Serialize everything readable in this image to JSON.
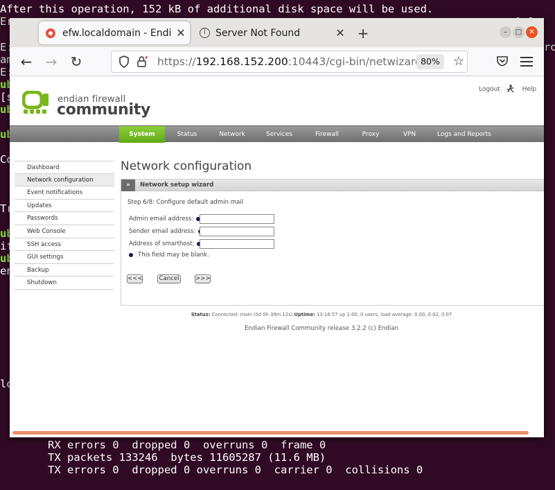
{
  "terminal": {
    "lines_top": [
      {
        "text": "After this operation, 152 kB of additional disk space will be used.",
        "style": "normal"
      },
      {
        "text": "Er",
        "style": "dim"
      },
      {
        "text": "E:",
        "style": "dim"
      },
      {
        "text": "am",
        "style": "dim"
      },
      {
        "text": "E:",
        "style": "dim"
      },
      {
        "text": "ub",
        "style": "green"
      },
      {
        "text": "[s",
        "style": "normal"
      },
      {
        "text": "ub",
        "style": "green"
      },
      {
        "text": "ub",
        "style": "green"
      },
      {
        "text": "Co",
        "style": "normal"
      },
      {
        "text": "Tr",
        "style": "normal"
      },
      {
        "text": "ub",
        "style": "green"
      },
      {
        "text": "if",
        "style": "normal"
      },
      {
        "text": "ub",
        "style": "green"
      },
      {
        "text": "en",
        "style": "normal"
      },
      {
        "text": "lo",
        "style": "normal"
      }
    ],
    "right_fragments": [
      "0-2",
      "rou"
    ],
    "lines_bottom": [
      "RX errors 0  dropped 0  overruns 0  frame 0",
      "TX packets 133246  bytes 11605287 (11.6 MB)",
      "TX errors 0  dropped 0 overruns 0  carrier 0  collisions 0"
    ]
  },
  "browser": {
    "tabs": [
      {
        "label": "efw.localdomain - Endian",
        "active": true,
        "icon": "endian-favicon"
      },
      {
        "label": "Server Not Found",
        "active": false,
        "icon": "info-icon"
      }
    ],
    "new_tab_label": "+",
    "url": {
      "scheme": "https://",
      "host": "192.168.152.200",
      "rest": ":10443/cgi-bin/netwizard.cgi"
    },
    "zoom": "80%"
  },
  "endian": {
    "logo": {
      "line1": "endian firewall",
      "line2": "community",
      "colors": {
        "green": "#7ab51d",
        "text": "#444444"
      }
    },
    "top_links": {
      "logout": "Logout",
      "help": "Help"
    },
    "menu": [
      {
        "label": "System",
        "active": true
      },
      {
        "label": "Status",
        "active": false
      },
      {
        "label": "Network",
        "active": false
      },
      {
        "label": "Services",
        "active": false
      },
      {
        "label": "Firewall",
        "active": false
      },
      {
        "label": "Proxy",
        "active": false
      },
      {
        "label": "VPN",
        "active": false
      },
      {
        "label": "Logs and Reports",
        "active": false
      }
    ],
    "sidebar": [
      {
        "label": "Dashboard",
        "active": false
      },
      {
        "label": "Network configuration",
        "active": true
      },
      {
        "label": "Event notifications",
        "active": false
      },
      {
        "label": "Updates",
        "active": false
      },
      {
        "label": "Passwords",
        "active": false
      },
      {
        "label": "Web Console",
        "active": false
      },
      {
        "label": "SSH access",
        "active": false
      },
      {
        "label": "GUI settings",
        "active": false
      },
      {
        "label": "Backup",
        "active": false
      },
      {
        "label": "Shutdown",
        "active": false
      }
    ],
    "page_title": "Network configuration",
    "wizard": {
      "header": "Network setup wizard",
      "header_icon": "»",
      "step": "Step 6/8: Configure default admin mail",
      "fields": [
        {
          "label": "Admin email address:",
          "value": ""
        },
        {
          "label": "Sender email address:",
          "value": ""
        },
        {
          "label": "Address of smarthost:",
          "value": ""
        }
      ],
      "note": "This field may be blank.",
      "buttons": {
        "back": "<<<",
        "cancel": "Cancel",
        "next": ">>>"
      }
    },
    "status": {
      "status_label": "Status:",
      "status_text": "Connected: main (0d 0h 39m 12s)",
      "uptime_label": "Uptime:",
      "uptime_text": "13:16:57 up 1:00, 0 users, load average: 0.00, 0.02, 0.07"
    },
    "release": "Endian Firewall Community release 3.2.2 (c) Endian"
  }
}
